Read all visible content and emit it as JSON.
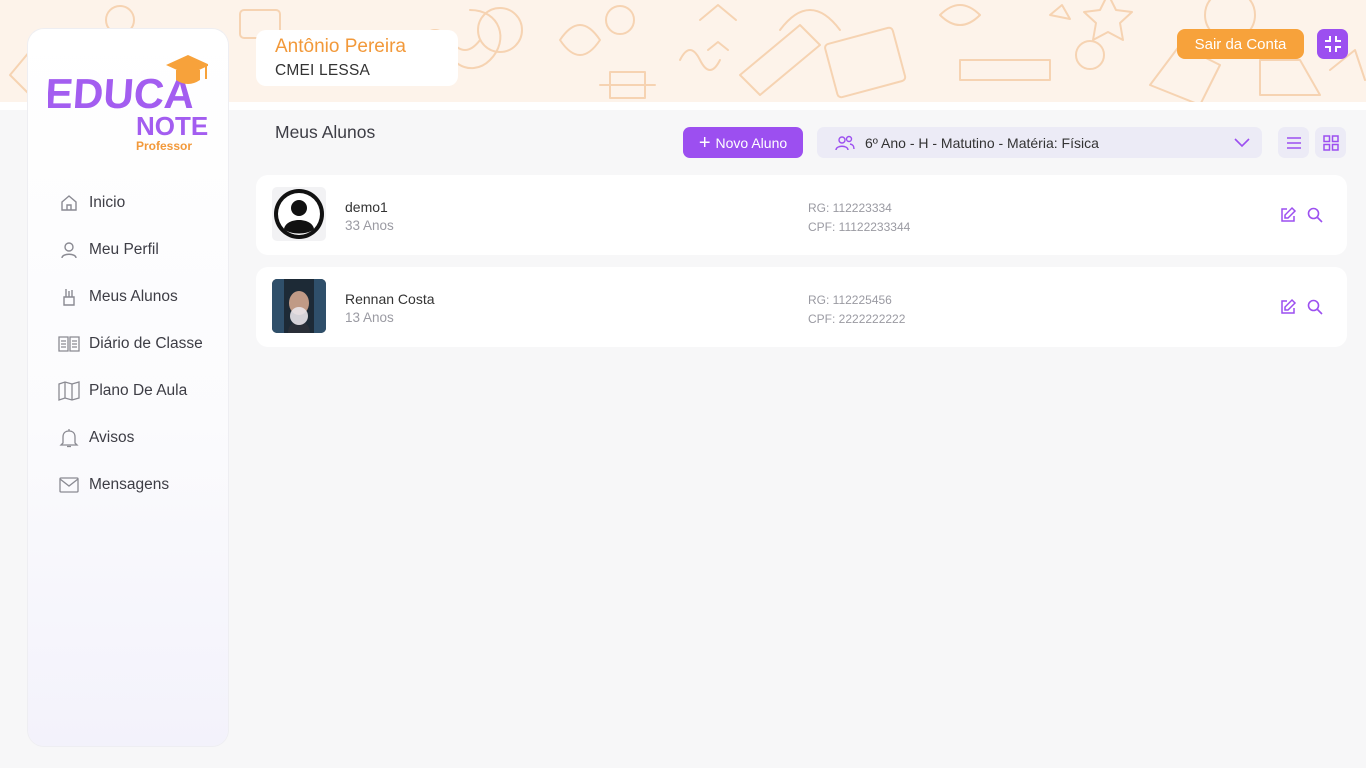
{
  "user": {
    "name": "Antônio Pereira",
    "school": "CMEI LESSA"
  },
  "header": {
    "logout_label": "Sair da Conta",
    "fullscreen_icon": "minimize-icon"
  },
  "logo": {
    "line1": "EDUCA",
    "line2": "NOTE",
    "line3": "Professor"
  },
  "sidebar": {
    "items": [
      {
        "label": "Inicio",
        "icon": "home-icon"
      },
      {
        "label": "Meu Perfil",
        "icon": "user-icon"
      },
      {
        "label": "Meus Alunos",
        "icon": "pencils-icon"
      },
      {
        "label": "Diário de Classe",
        "icon": "book-icon"
      },
      {
        "label": "Plano De Aula",
        "icon": "map-icon"
      },
      {
        "label": "Avisos",
        "icon": "bell-icon"
      },
      {
        "label": "Mensagens",
        "icon": "mail-icon"
      }
    ]
  },
  "main": {
    "title": "Meus Alunos",
    "new_button": "Novo Aluno",
    "class_select": {
      "value": "6º Ano - H - Matutino - Matéria: Física"
    },
    "students": [
      {
        "name": "demo1",
        "age": "33 Anos",
        "rg": "RG: 112223334",
        "cpf": "CPF: 11122233344"
      },
      {
        "name": "Rennan Costa",
        "age": "13 Anos",
        "rg": "RG: 112225456",
        "cpf": "CPF: 2222222222"
      }
    ]
  },
  "colors": {
    "accent": "#9c4ff0",
    "orange": "#f7a23b",
    "name": "#f2993a"
  }
}
